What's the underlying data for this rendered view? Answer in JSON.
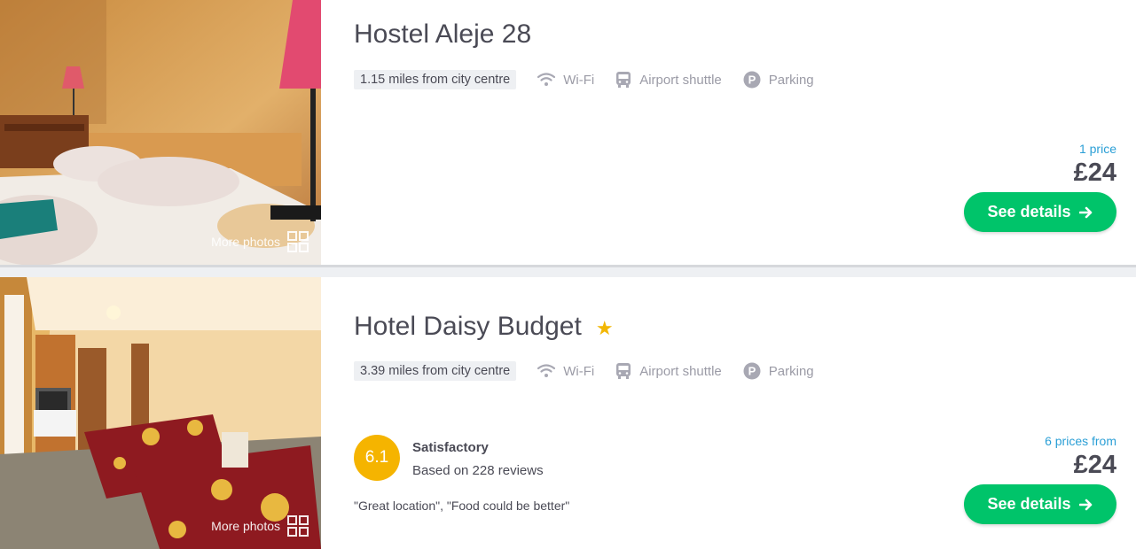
{
  "hotels": [
    {
      "name": "Hostel Aleje 28",
      "distance": "1.15 miles from city centre",
      "amenities": [
        {
          "icon": "wifi-icon",
          "label": "Wi-Fi"
        },
        {
          "icon": "bus-icon",
          "label": "Airport shuttle"
        },
        {
          "icon": "parking-icon",
          "label": "Parking"
        }
      ],
      "more_photos": "More photos",
      "price_note": "1 price",
      "price": "£24",
      "button": "See details"
    },
    {
      "name": "Hotel Daisy Budget",
      "stars": 1,
      "distance": "3.39 miles from city centre",
      "amenities": [
        {
          "icon": "wifi-icon",
          "label": "Wi-Fi"
        },
        {
          "icon": "bus-icon",
          "label": "Airport shuttle"
        },
        {
          "icon": "parking-icon",
          "label": "Parking"
        }
      ],
      "more_photos": "More photos",
      "rating": {
        "score": "6.1",
        "label": "Satisfactory",
        "reviews": "Based on 228 reviews"
      },
      "quote": "\"Great location\", \"Food could be better\"",
      "price_note": "6 prices from",
      "price": "£24",
      "button": "See details"
    }
  ],
  "colors": {
    "accent": "#00c46a",
    "link": "#2b9fd6",
    "score": "#f5b400",
    "star": "#f2b705"
  }
}
